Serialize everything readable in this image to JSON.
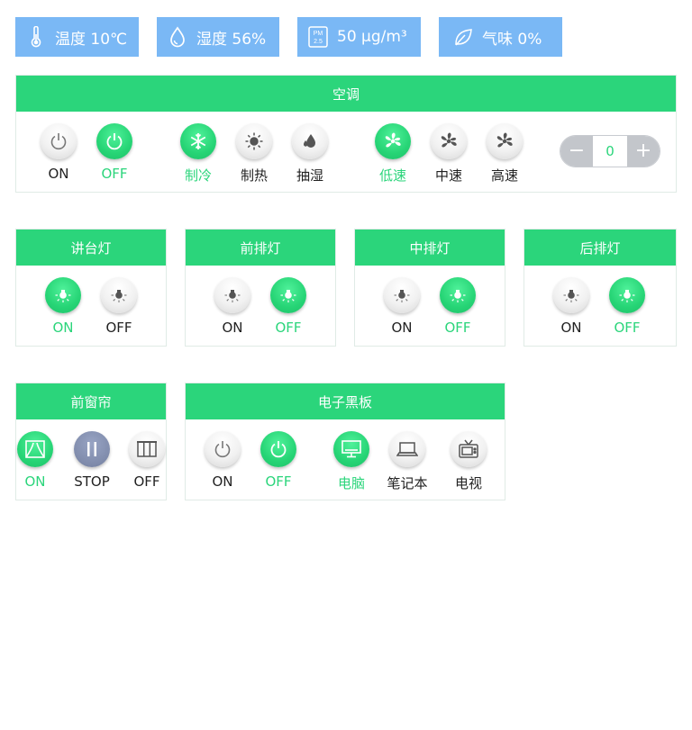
{
  "sensors": {
    "temperature": "温度 10℃",
    "humidity": "湿度 56%",
    "pm25": "50 μg/m³",
    "odor": "气味 0%",
    "pm_icon_text": [
      "PM",
      "2.5"
    ]
  },
  "aircon": {
    "title": "空调",
    "power_on": "ON",
    "power_off": "OFF",
    "mode_cool": "制冷",
    "mode_heat": "制热",
    "mode_dry": "抽湿",
    "fan_low": "低速",
    "fan_mid": "中速",
    "fan_high": "高速",
    "stepper_value": "0",
    "stepper_minus": "−",
    "stepper_plus": "+"
  },
  "lights": [
    {
      "title": "讲台灯",
      "on": "ON",
      "off": "OFF",
      "state": "on"
    },
    {
      "title": "前排灯",
      "on": "ON",
      "off": "OFF",
      "state": "off"
    },
    {
      "title": "中排灯",
      "on": "ON",
      "off": "OFF",
      "state": "off"
    },
    {
      "title": "后排灯",
      "on": "ON",
      "off": "OFF",
      "state": "off"
    }
  ],
  "curtain": {
    "title": "前窗帘",
    "on": "ON",
    "stop": "STOP",
    "off": "OFF"
  },
  "board": {
    "title": "电子黑板",
    "power_on": "ON",
    "power_off": "OFF",
    "src_pc": "电脑",
    "src_laptop": "笔记本",
    "src_tv": "电视"
  },
  "colors": {
    "accent": "#2bd57b",
    "sensor_bg": "#7ab8f5",
    "stop": "#7f8bab"
  }
}
